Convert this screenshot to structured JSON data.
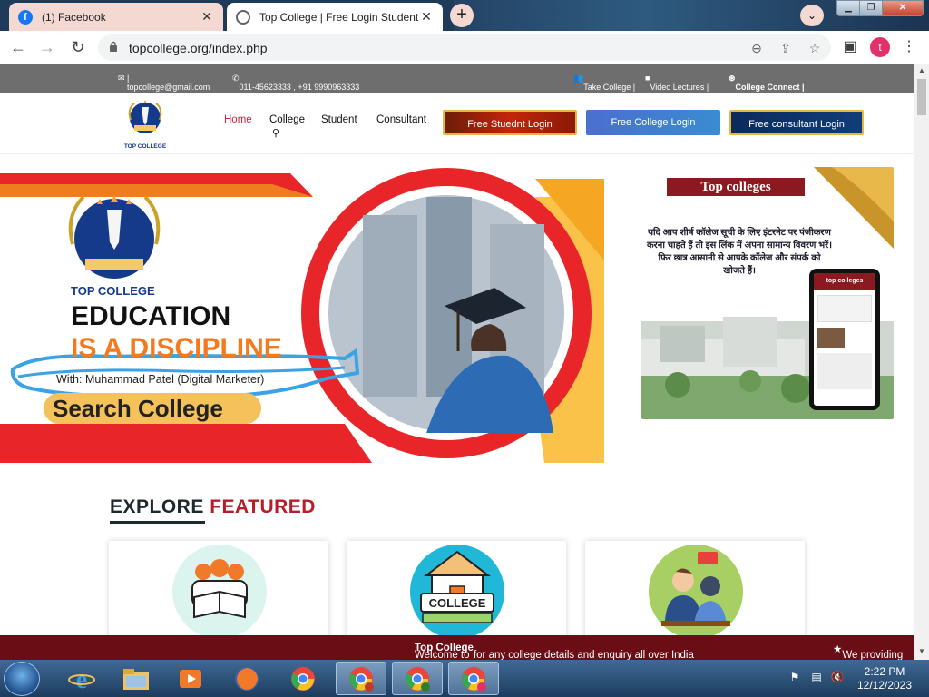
{
  "browser": {
    "tabs": [
      {
        "label": "(1) Facebook",
        "icon": "facebook-icon",
        "active": false
      },
      {
        "label": "Top College | Free Login Student",
        "icon": "globe-icon",
        "active": true
      }
    ],
    "url": "topcollege.org/index.php",
    "profile_initial": "t"
  },
  "site": {
    "topinfo": {
      "email": "topcollege@gmail.com",
      "phone": "011-45623333 , +91 9990963333",
      "take_college": "Take College |",
      "video_lectures": "Video Lectures |",
      "college_connect": "College Connect |"
    },
    "logo_text": "TOP COLLEGE",
    "nav": {
      "home": "Home",
      "college": "College",
      "student": "Student",
      "consultant": "Consultant"
    },
    "buttons": {
      "student_login": "Free Stuednt Login",
      "college_login": "Free College Login",
      "consultant_login": "Free consultant Login"
    },
    "hero": {
      "brand": "TOP COLLEGE",
      "headline": "EDUCATION",
      "subline": "IS A DISCIPLINE",
      "with_text": "With: Muhammad Patel (Digital Marketer)",
      "search_label": "Search College"
    },
    "promo": {
      "title": "Top colleges",
      "hindi_text": "यदि आप शीर्ष कॉलेज सूची के लिए इंटरनेट पर पंजीकरण करना चाहते हैं तो इस लिंक में अपना सामान्य विवरण भरें। फिर छात्र आसानी से आपके कॉलेज और संपर्क को खोजते हैं।",
      "phone_header": "top colleges"
    },
    "explore": {
      "title_part1": "EXPLORE",
      "title_part2": "FEATURED"
    },
    "featured_icons": [
      "students-reading-icon",
      "college-building-icon",
      "consultation-icon"
    ],
    "college_badge": "COLLEGE",
    "ticker": {
      "welcome_prefix": "Welcome to",
      "brand": "Top College",
      "welcome_suffix": "for any college details and enquiry all over India",
      "providing": "We providing"
    }
  },
  "taskbar": {
    "time": "2:22 PM",
    "date": "12/12/2023",
    "apps": [
      "internet-explorer-icon",
      "file-explorer-icon",
      "media-player-icon",
      "firefox-icon",
      "chrome-icon",
      "chrome-profile-v-icon",
      "chrome-profile-t-icon",
      "chrome-profile-t2-icon"
    ]
  },
  "colors": {
    "accent_red": "#b71c2a",
    "topbar_grey": "#6e6e6e",
    "ticker_bg": "#6a0d14",
    "nav_active": "#d0243f"
  }
}
